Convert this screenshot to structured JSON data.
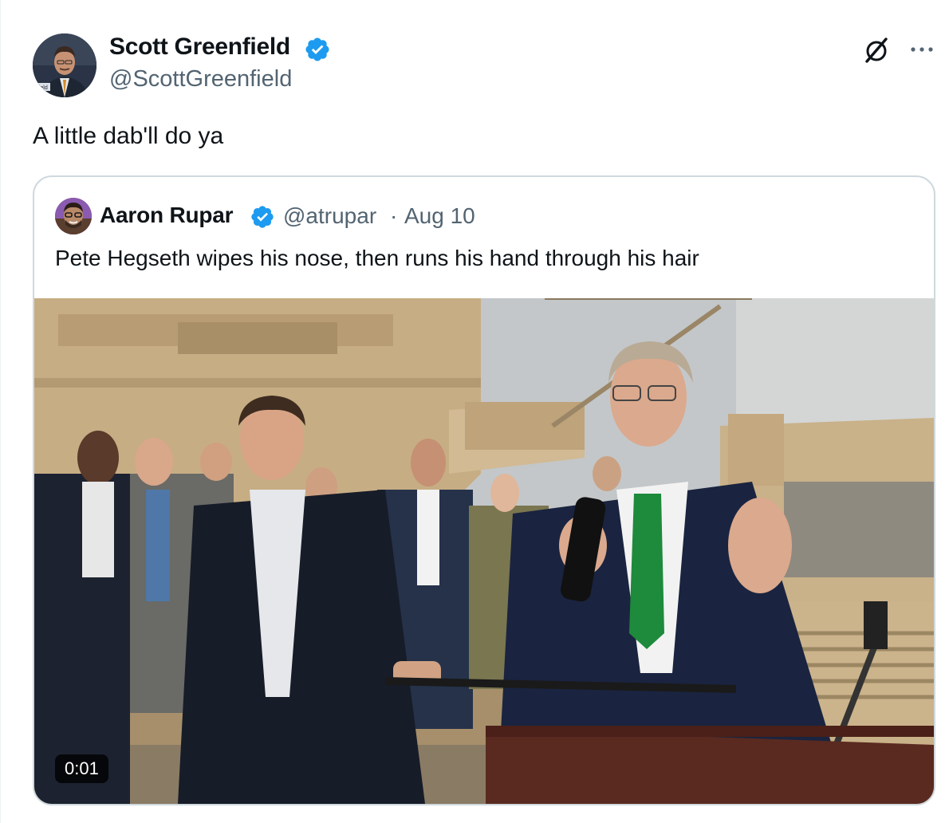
{
  "tweet": {
    "author_name": "Scott Greenfield",
    "author_handle": "@ScottGreenfield",
    "avatar_badge": "nfield",
    "text": "A little dab'll do ya"
  },
  "quoted_tweet": {
    "author_name": "Aaron Rupar",
    "author_handle": "@atrupar",
    "separator": "·",
    "date": "Aug 10",
    "text": "Pete Hegseth wipes his nose, then runs his hand through his hair",
    "video_duration": "0:01"
  },
  "icons": {
    "verified": "verified-badge-icon",
    "grok": "grok-icon",
    "more": "more-icon"
  },
  "colors": {
    "verified_blue": "#1d9bf0",
    "text_primary": "#0f1419",
    "text_secondary": "#536471",
    "border": "#cfd9de"
  }
}
